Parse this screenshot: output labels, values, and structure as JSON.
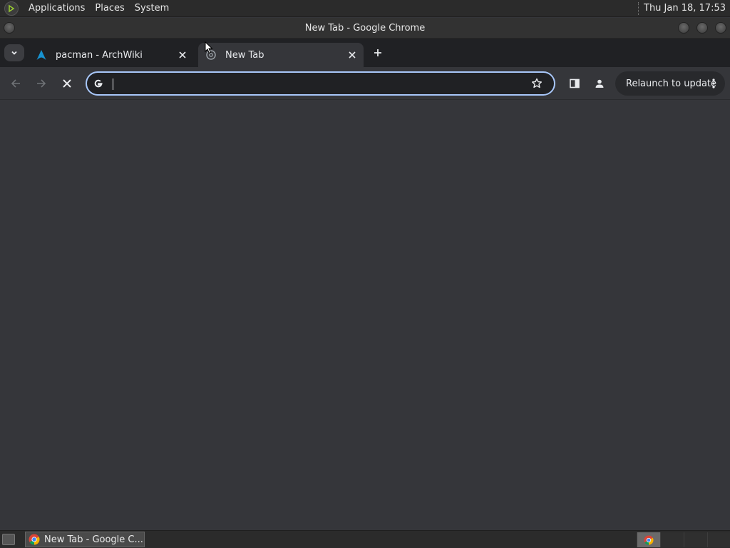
{
  "panel": {
    "menus": [
      "Applications",
      "Places",
      "System"
    ],
    "clock": "Thu Jan 18, 17:53"
  },
  "window": {
    "title": "New Tab - Google Chrome"
  },
  "tabs": [
    {
      "title": "pacman - ArchWiki",
      "favicon": "archlinux-icon",
      "active": false
    },
    {
      "title": "New Tab",
      "favicon": "chrome-newtab-icon",
      "active": true
    }
  ],
  "omnibox": {
    "value": "",
    "placeholder": ""
  },
  "toolbar": {
    "relaunch_label": "Relaunch to update"
  },
  "taskbar": {
    "task_label": "New Tab - Google C..."
  },
  "colors": {
    "tabstrip_bg": "#202124",
    "toolbar_bg": "#35363a",
    "omnibox_focus": "#a8c7fa",
    "panel_bg": "#2b2b2b"
  }
}
